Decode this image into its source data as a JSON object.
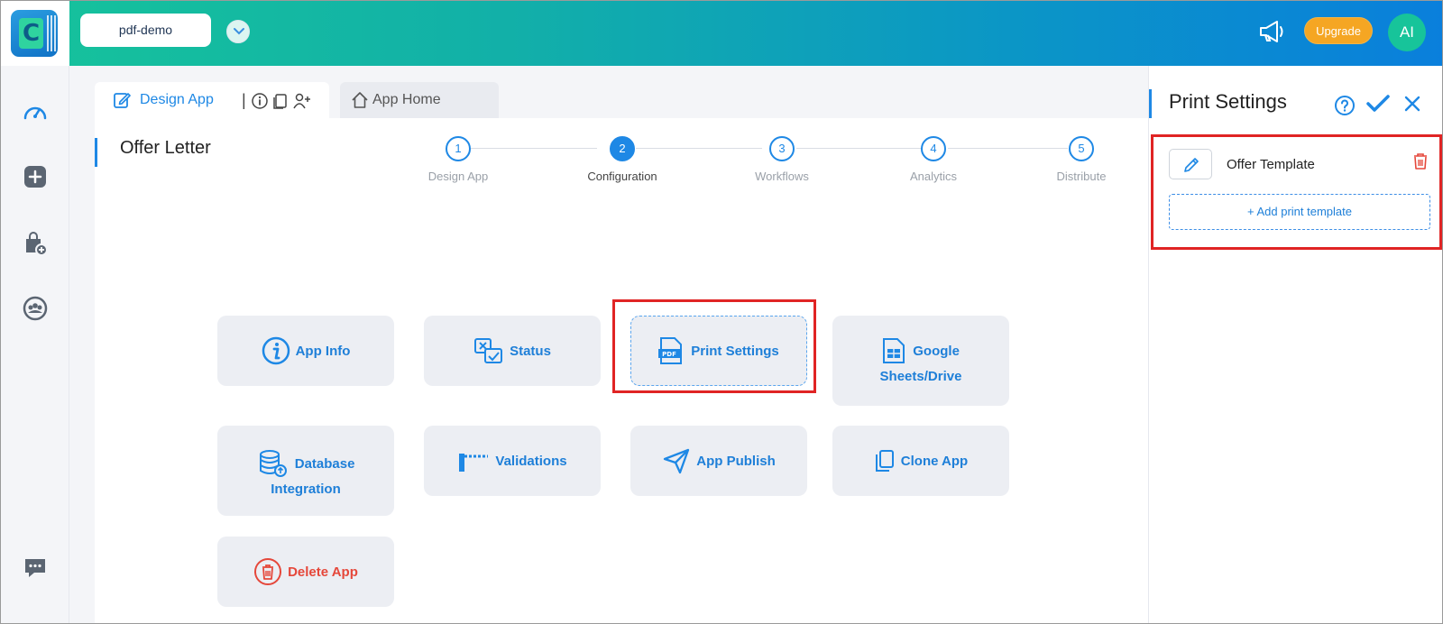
{
  "header": {
    "logo_letter": "C",
    "project_name": "pdf-demo",
    "upgrade_label": "Upgrade",
    "avatar_initials": "AI"
  },
  "rail": {
    "items": [
      "dashboard-icon",
      "add-app-icon",
      "marketplace-icon",
      "team-icon",
      "chat-icon"
    ]
  },
  "tabs": {
    "design_label": "Design App",
    "separator": "|",
    "home_label": "App Home"
  },
  "app": {
    "title": "Offer Letter"
  },
  "stepper": {
    "steps": [
      {
        "number": "1",
        "label": "Design App",
        "active": false
      },
      {
        "number": "2",
        "label": "Configuration",
        "active": true
      },
      {
        "number": "3",
        "label": "Workflows",
        "active": false
      },
      {
        "number": "4",
        "label": "Analytics",
        "active": false
      },
      {
        "number": "5",
        "label": "Distribute",
        "active": false
      }
    ]
  },
  "tiles": {
    "app_info": "App Info",
    "status": "Status",
    "print_settings": "Print Settings",
    "google_line1": "Google",
    "google_line2": "Sheets/Drive",
    "database_line1": "Database",
    "database_line2": "Integration",
    "validations": "Validations",
    "app_publish": "App Publish",
    "clone_app": "Clone App",
    "delete_app": "Delete App"
  },
  "panel": {
    "title": "Print Settings",
    "templates": [
      {
        "name": "Offer Template"
      }
    ],
    "add_template_label": "+ Add print template"
  },
  "colors": {
    "accent": "#1e88e5",
    "highlight": "#e02424",
    "upgrade": "#f5a623",
    "danger": "#e5473a"
  }
}
